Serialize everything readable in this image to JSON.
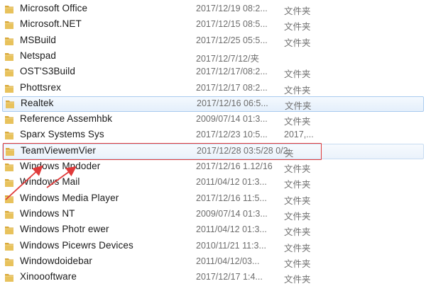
{
  "folders": [
    {
      "name": "Microsoft Office",
      "date": "2017/12/19 08:2...",
      "type": "文件夹"
    },
    {
      "name": "Microsoft.NET",
      "date": "2017/12/15 08:5...",
      "type": "文件夹"
    },
    {
      "name": "MSBuild",
      "date": "2017/12/25 05:5...",
      "type": "文件夹"
    },
    {
      "name": "Netspad",
      "date": "2017/12/7/12/夹",
      "type": ""
    },
    {
      "name": "OST'S3Build",
      "date": "2017/12/17/08:2...",
      "type": "文件夹"
    },
    {
      "name": "Phottsrex",
      "date": "2017/12/17 08:2...",
      "type": "文件夹"
    },
    {
      "name": "Realtek",
      "date": "2017/12/16 06:5...",
      "type": "文件夹"
    },
    {
      "name": "Reference Assemhbk",
      "date": "2009/07/14 01:3...",
      "type": "文件夹"
    },
    {
      "name": "Sparx Systems  Sys",
      "date": "2017/12/23 10:5...",
      "type": "2017,..."
    },
    {
      "name": "TeamViewemVier",
      "date": "2017/12/28 03:5/28 0/2",
      "type": "夹"
    },
    {
      "name": "Windows Mndoder",
      "date": "2017/12/16 1.12/16",
      "type": "文件夹"
    },
    {
      "name": "Windows Mail",
      "date": "2011/04/12 01:3...",
      "type": "文件夹"
    },
    {
      "name": "Windows Media Player",
      "date": "2017/12/16 11:5...",
      "type": "文件夹"
    },
    {
      "name": "Windows NT",
      "date": "2009/07/14 01:3...",
      "type": "文件夹"
    },
    {
      "name": "Windows Photr  ewer",
      "date": "2011/04/12 01:3...",
      "type": "文件夹"
    },
    {
      "name": "Windows Picewrs Devices",
      "date": "2010/11/21 11:3...",
      "type": "文件夹"
    },
    {
      "name": "Windowdoidebar",
      "date": "2011/04/12/03...",
      "type": "文件夹"
    },
    {
      "name": "Xinoooftware",
      "date": "2017/12/17 1:4...",
      "type": "文件夹"
    }
  ],
  "selected_index": 6,
  "highlighted_index": 9,
  "colors": {
    "folder_body": "#e8c25c",
    "folder_tab": "#d9a93a",
    "annotation": "#e03a3a",
    "selection_border": "#a9cbee"
  }
}
